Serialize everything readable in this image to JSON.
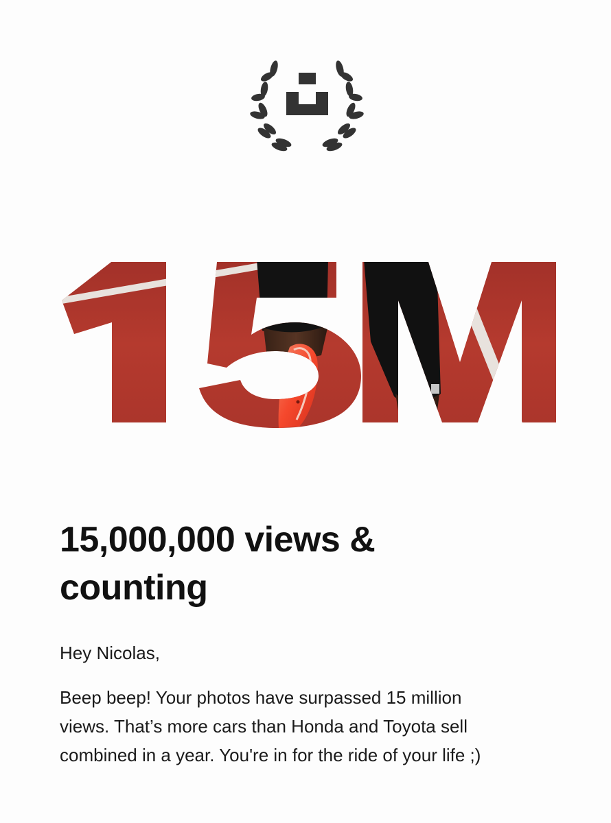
{
  "logo": {
    "icon": "unsplash-award-laurel-icon",
    "color": "#333333"
  },
  "hero": {
    "text": "15M",
    "photo": "athlete-running-on-red-track-with-orange-spikes",
    "colors": {
      "track": "#b8392e",
      "lane_line": "#f2ece6",
      "shorts": "#121212",
      "shoe": "#ff5a3c"
    }
  },
  "headline": {
    "line1": "15,000,000 views &",
    "line2": "counting"
  },
  "greeting": "Hey Nicolas,",
  "body": {
    "line1": "Beep beep! Your photos have surpassed 15 million",
    "line2": "views. That’s more cars than Honda and Toyota sell",
    "line3": "combined in a year. You're in for the ride of your life ;)"
  }
}
